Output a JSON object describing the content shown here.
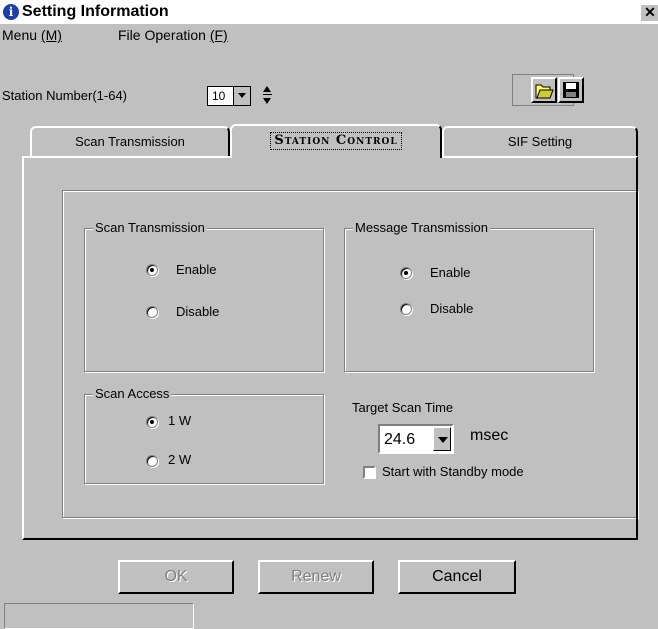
{
  "window": {
    "title": "Setting Information",
    "close_glyph": "✕",
    "icon": "info-icon"
  },
  "menu": {
    "items": [
      {
        "label": "Menu",
        "mnemonic": "(M)"
      },
      {
        "label": "File Operation",
        "mnemonic": "(F)"
      }
    ]
  },
  "station": {
    "label": "Station Number(1-64)",
    "value": "10"
  },
  "toolbar": {
    "open_icon": "folder-open-icon",
    "save_icon": "floppy-disk-icon"
  },
  "tabs": [
    {
      "label": "Scan Transmission",
      "active": false
    },
    {
      "label": "Station Control",
      "active": true
    },
    {
      "label": "SIF Setting",
      "active": false
    }
  ],
  "scan_transmission": {
    "title": "Scan Transmission",
    "options": [
      {
        "label": "Enable",
        "selected": true
      },
      {
        "label": "Disable",
        "selected": false
      }
    ]
  },
  "message_transmission": {
    "title": "Message Transmission",
    "options": [
      {
        "label": "Enable",
        "selected": true
      },
      {
        "label": "Disable",
        "selected": false
      }
    ]
  },
  "scan_access": {
    "title": "Scan Access",
    "options": [
      {
        "label": "1 W",
        "selected": true
      },
      {
        "label": "2 W",
        "selected": false
      }
    ]
  },
  "target_scan_time": {
    "label": "Target Scan Time",
    "value": "24.6",
    "unit": "msec"
  },
  "standby": {
    "label": "Start with Standby mode",
    "checked": false
  },
  "buttons": {
    "ok": "OK",
    "renew": "Renew",
    "cancel": "Cancel"
  },
  "colors": {
    "face": "#c0c0c0",
    "highlight": "#ffffff",
    "shadow": "#808080",
    "title_icon": "#1c3fa8"
  }
}
